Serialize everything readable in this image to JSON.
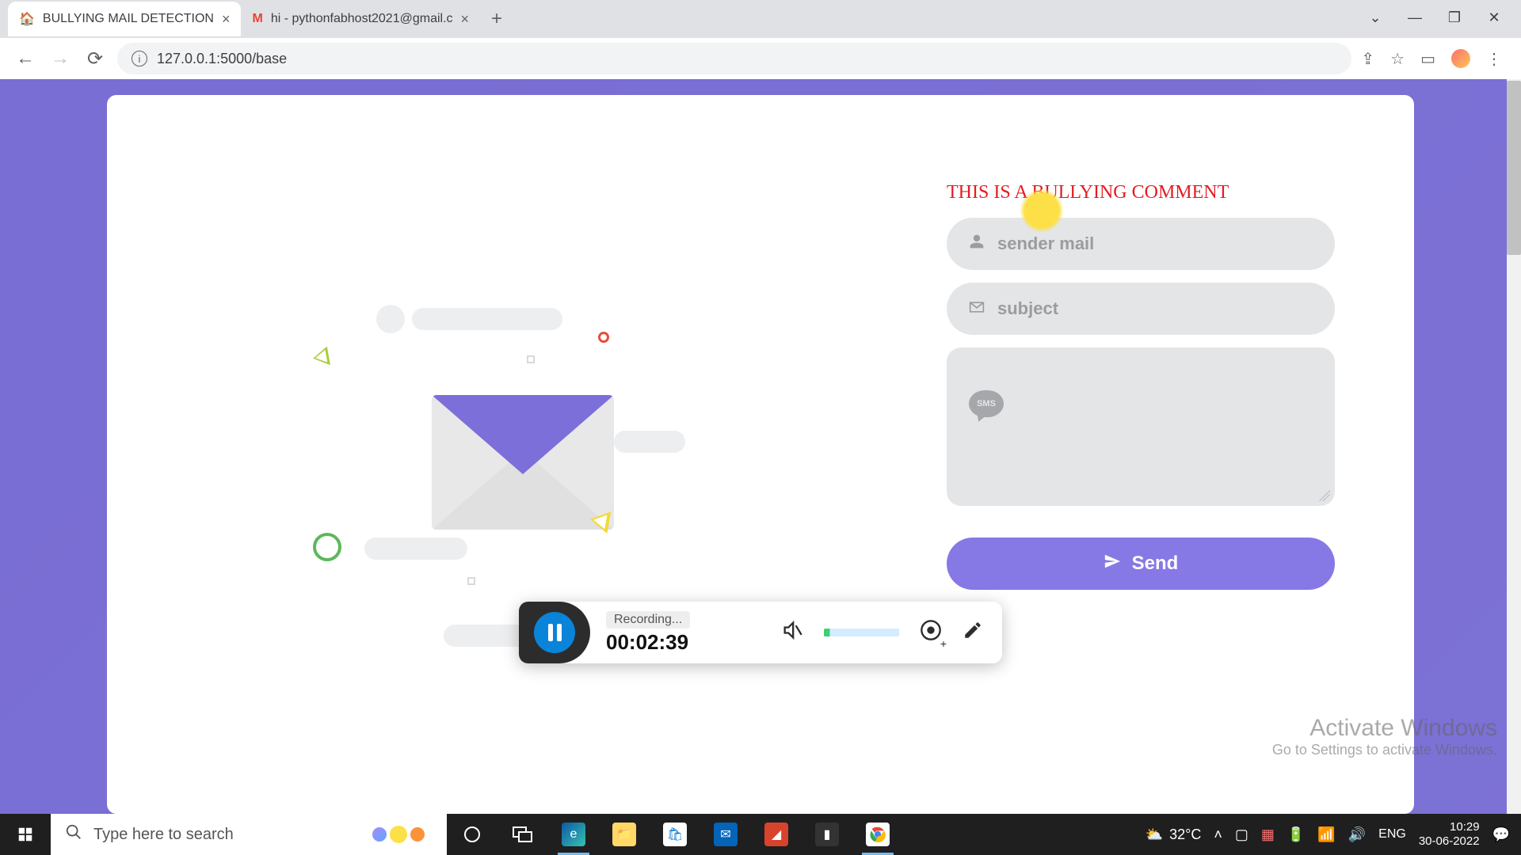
{
  "browser": {
    "tabs": [
      {
        "title": "BULLYING MAIL DETECTION",
        "active": true
      },
      {
        "title": "hi - pythonfabhost2021@gmail.c",
        "active": false
      }
    ],
    "url": "127.0.0.1:5000/base"
  },
  "page": {
    "alert": "THIS IS A BULLYING COMMENT",
    "form": {
      "sender_placeholder": "sender mail",
      "subject_placeholder": "subject",
      "message_placeholder": "",
      "sms_label": "SMS",
      "send_label": "Send"
    }
  },
  "recorder": {
    "status": "Recording...",
    "time": "00:02:39"
  },
  "watermark": {
    "title": "Activate Windows",
    "subtitle": "Go to Settings to activate Windows."
  },
  "taskbar": {
    "search_placeholder": "Type here to search",
    "weather_temp": "32°C",
    "lang": "ENG",
    "time": "10:29",
    "date": "30-06-2022"
  }
}
